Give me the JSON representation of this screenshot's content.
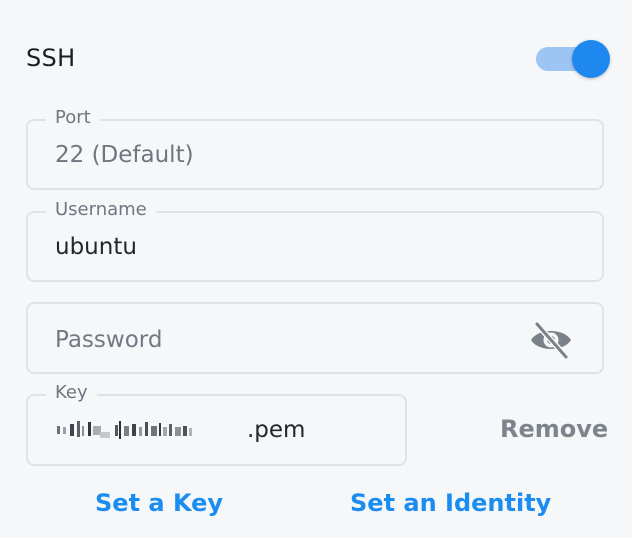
{
  "ssh": {
    "title": "SSH",
    "enabled": true,
    "toggle_track_color": "#9cc5f4",
    "toggle_knob_color": "#1e88f0"
  },
  "fields": {
    "port": {
      "label": "Port",
      "value": "22 (Default)"
    },
    "username": {
      "label": "Username",
      "value": "ubuntu"
    },
    "password": {
      "placeholder": "Password",
      "visibility_icon": "eye-off-icon"
    },
    "key": {
      "label": "Key",
      "value_suffix": ".pem"
    }
  },
  "actions": {
    "remove": "Remove",
    "set_key": "Set a Key",
    "set_identity": "Set an Identity"
  },
  "colors": {
    "accent": "#1b8cf0",
    "muted_text": "#6f7680",
    "border": "#dfe3e8",
    "background": "#f6f7f9"
  }
}
